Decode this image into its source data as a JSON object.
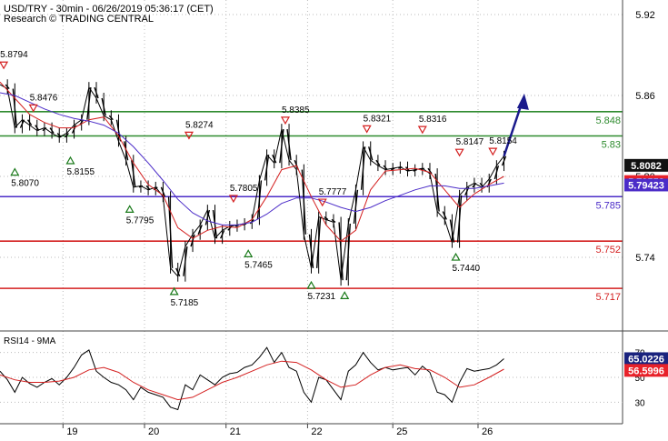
{
  "header": {
    "title": "USD/TRY - 30min - 06/26/2019 05:36:17 (CET)",
    "subtitle": "Research © TRADING CENTRAL"
  },
  "chart_data": [
    {
      "type": "line",
      "panel": "price",
      "ylim": [
        5.71,
        5.93
      ],
      "y_ticks": [
        "5.92",
        "5.86",
        "5.80",
        "5.74"
      ],
      "x_ticks": [
        "19",
        "20",
        "21",
        "22",
        "25",
        "26"
      ],
      "horizontal_levels": [
        {
          "value": 5.848,
          "label": "5.848",
          "color": "#2e8b2e"
        },
        {
          "value": 5.83,
          "label": "5.83",
          "color": "#2e8b2e"
        },
        {
          "value": 5.785,
          "label": "5.785",
          "color": "#4b2cc8"
        },
        {
          "value": 5.752,
          "label": "5.752",
          "color": "#d42020"
        },
        {
          "value": 5.717,
          "label": "5.717",
          "color": "#d42020"
        }
      ],
      "current_price": {
        "value": 5.8082,
        "label": "5.8082"
      },
      "ma_fast_value": {
        "value": 5.79558,
        "label": "5.79558",
        "color": "#d42020"
      },
      "ma_slow_value": {
        "value": 5.79423,
        "label": "5.79423",
        "color": "#4b2cc8"
      },
      "swing_labels": [
        {
          "x": 0.5,
          "value": 5.8794,
          "label": "5.8794",
          "kind": "high"
        },
        {
          "x": 4.5,
          "value": 5.8476,
          "label": "5.8476",
          "kind": "high"
        },
        {
          "x": 2,
          "value": 5.807,
          "label": "5.8070",
          "kind": "low"
        },
        {
          "x": 9.5,
          "value": 5.8155,
          "label": "5.8155",
          "kind": "low"
        },
        {
          "x": 17.5,
          "value": 5.7795,
          "label": "5.7795",
          "kind": "low"
        },
        {
          "x": 23.5,
          "value": 5.7185,
          "label": "5.7185",
          "kind": "low"
        },
        {
          "x": 25.5,
          "value": 5.8274,
          "label": "5.8274",
          "kind": "high"
        },
        {
          "x": 31.5,
          "value": 5.7805,
          "label": "5.7805",
          "kind": "high"
        },
        {
          "x": 33.5,
          "value": 5.7465,
          "label": "5.7465",
          "kind": "low"
        },
        {
          "x": 38.5,
          "value": 5.8385,
          "label": "5.8385",
          "kind": "high"
        },
        {
          "x": 43.5,
          "value": 5.7777,
          "label": "5.7777",
          "kind": "high"
        },
        {
          "x": 42,
          "value": 5.7231,
          "label": "5.7231",
          "kind": "low"
        },
        {
          "x": 46.5,
          "value": 5.7155,
          "label": "",
          "kind": "low"
        },
        {
          "x": 49.5,
          "value": 5.8321,
          "label": "5.8321",
          "kind": "high"
        },
        {
          "x": 57,
          "value": 5.8316,
          "label": "5.8316",
          "kind": "high"
        },
        {
          "x": 61.5,
          "value": 5.744,
          "label": "5.7440",
          "kind": "low"
        },
        {
          "x": 62,
          "value": 5.8147,
          "label": "5.8147",
          "kind": "high"
        },
        {
          "x": 66.5,
          "value": 5.8154,
          "label": "5.8154",
          "kind": "high"
        }
      ],
      "x_domain": [
        0,
        84
      ],
      "x_tick_positions": [
        8.5,
        19.5,
        30.5,
        41.5,
        53,
        64.5
      ],
      "series": [
        {
          "name": "",
          "color": "#000000",
          "x": [
            0,
            1,
            2,
            3,
            4,
            5,
            6,
            7,
            8,
            9,
            10,
            11,
            12,
            13,
            14,
            15,
            16,
            17,
            18,
            19,
            20,
            21,
            22,
            23,
            24,
            25,
            26,
            27,
            28,
            29,
            30,
            31,
            32,
            33,
            34,
            35,
            36,
            37,
            38,
            39,
            40,
            41,
            42,
            43,
            44,
            45,
            46,
            47,
            48,
            49,
            50,
            51,
            52,
            53,
            54,
            55,
            56,
            57,
            58,
            59,
            60,
            61,
            62,
            63,
            64,
            65,
            66,
            67,
            68
          ],
          "values": [
            5.868,
            5.865,
            5.836,
            5.842,
            5.838,
            5.834,
            5.836,
            5.832,
            5.829,
            5.832,
            5.838,
            5.842,
            5.866,
            5.858,
            5.845,
            5.842,
            5.826,
            5.812,
            5.792,
            5.793,
            5.79,
            5.792,
            5.785,
            5.732,
            5.726,
            5.748,
            5.757,
            5.764,
            5.775,
            5.754,
            5.76,
            5.763,
            5.764,
            5.765,
            5.768,
            5.797,
            5.816,
            5.81,
            5.835,
            5.812,
            5.805,
            5.757,
            5.732,
            5.77,
            5.768,
            5.766,
            5.723,
            5.765,
            5.79,
            5.822,
            5.812,
            5.808,
            5.805,
            5.806,
            5.807,
            5.804,
            5.805,
            5.806,
            5.802,
            5.774,
            5.768,
            5.751,
            5.786,
            5.792,
            5.795,
            5.792,
            5.798,
            5.808,
            5.815
          ]
        },
        {
          "name": "",
          "color": "#d42020",
          "x": [
            0,
            2,
            4,
            6,
            8,
            10,
            12,
            14,
            16,
            18,
            20,
            22,
            24,
            26,
            28,
            30,
            32,
            34,
            36,
            38,
            40,
            42,
            44,
            46,
            48,
            50,
            52,
            54,
            56,
            58,
            60,
            62,
            64,
            66,
            68
          ],
          "values": [
            5.87,
            5.858,
            5.846,
            5.84,
            5.836,
            5.836,
            5.842,
            5.844,
            5.83,
            5.81,
            5.794,
            5.786,
            5.762,
            5.754,
            5.76,
            5.763,
            5.762,
            5.768,
            5.785,
            5.805,
            5.808,
            5.785,
            5.764,
            5.752,
            5.76,
            5.79,
            5.804,
            5.805,
            5.806,
            5.803,
            5.79,
            5.777,
            5.787,
            5.794,
            5.8
          ]
        },
        {
          "name": "",
          "color": "#4b2cc8",
          "x": [
            0,
            2,
            4,
            6,
            8,
            10,
            12,
            14,
            16,
            18,
            20,
            22,
            24,
            26,
            28,
            30,
            32,
            34,
            36,
            38,
            40,
            42,
            44,
            46,
            48,
            50,
            52,
            54,
            56,
            58,
            60,
            62,
            64,
            66,
            68
          ],
          "values": [
            5.862,
            5.86,
            5.855,
            5.85,
            5.846,
            5.843,
            5.841,
            5.838,
            5.832,
            5.822,
            5.81,
            5.797,
            5.783,
            5.773,
            5.767,
            5.764,
            5.764,
            5.766,
            5.772,
            5.78,
            5.784,
            5.784,
            5.781,
            5.777,
            5.774,
            5.777,
            5.782,
            5.786,
            5.79,
            5.793,
            5.793,
            5.791,
            5.791,
            5.793,
            5.795
          ]
        }
      ],
      "projection": {
        "x": [
          68,
          70.5
        ],
        "values": [
          5.815,
          5.852
        ],
        "color": "#1a1a8c"
      }
    },
    {
      "type": "line",
      "panel": "indicator",
      "title": "RSI14 - 9MA",
      "ylim": [
        20,
        80
      ],
      "y_ticks": [
        "70",
        "50",
        "30"
      ],
      "current_value": {
        "value": 65.0226,
        "label": "65.0226"
      },
      "ma_value": {
        "value": 56.5996,
        "label": "56.5996"
      },
      "x_domain": [
        0,
        84
      ],
      "series": [
        {
          "name": "",
          "color": "#000000",
          "x": [
            0,
            1,
            2,
            3,
            4,
            5,
            6,
            7,
            8,
            9,
            10,
            11,
            12,
            13,
            14,
            15,
            16,
            17,
            18,
            19,
            20,
            21,
            22,
            23,
            24,
            25,
            26,
            27,
            28,
            29,
            30,
            31,
            32,
            33,
            34,
            35,
            36,
            37,
            38,
            39,
            40,
            41,
            42,
            43,
            44,
            45,
            46,
            47,
            48,
            49,
            50,
            51,
            52,
            53,
            54,
            55,
            56,
            57,
            58,
            59,
            60,
            61,
            62,
            63,
            64,
            65,
            66,
            67,
            68
          ],
          "values": [
            55,
            48,
            38,
            50,
            45,
            42,
            46,
            49,
            44,
            50,
            58,
            68,
            72,
            55,
            50,
            46,
            44,
            40,
            32,
            42,
            38,
            36,
            34,
            26,
            24,
            44,
            40,
            52,
            48,
            44,
            50,
            53,
            54,
            58,
            60,
            66,
            74,
            62,
            70,
            58,
            55,
            38,
            30,
            50,
            48,
            40,
            32,
            55,
            60,
            70,
            62,
            56,
            58,
            56,
            57,
            58,
            52,
            59,
            54,
            38,
            36,
            30,
            46,
            57,
            55,
            56,
            57,
            60,
            65
          ]
        },
        {
          "name": "",
          "color": "#d42020",
          "x": [
            0,
            2,
            4,
            6,
            8,
            10,
            12,
            14,
            16,
            18,
            20,
            22,
            24,
            26,
            28,
            30,
            32,
            34,
            36,
            38,
            40,
            42,
            44,
            46,
            48,
            50,
            52,
            54,
            56,
            58,
            60,
            62,
            64,
            66,
            68
          ],
          "values": [
            52,
            48,
            46,
            46,
            47,
            50,
            56,
            58,
            54,
            46,
            40,
            36,
            32,
            34,
            40,
            46,
            50,
            55,
            60,
            63,
            62,
            56,
            48,
            42,
            44,
            52,
            58,
            60,
            57,
            56,
            50,
            42,
            44,
            50,
            56.6
          ]
        }
      ]
    }
  ]
}
